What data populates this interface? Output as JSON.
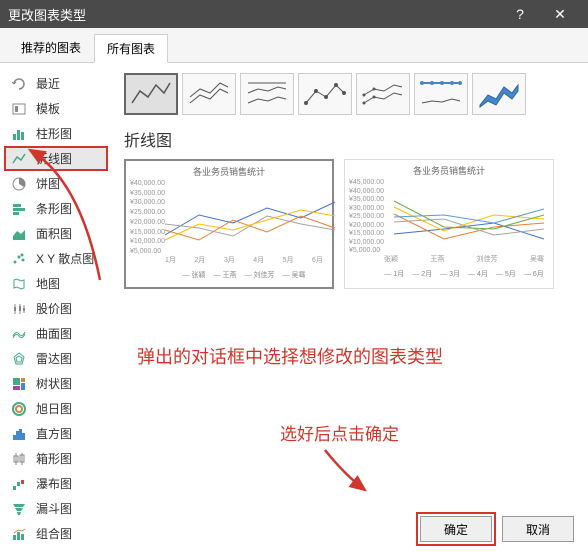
{
  "titlebar": {
    "title": "更改图表类型"
  },
  "tabs": {
    "recommended": "推荐的图表",
    "all": "所有图表"
  },
  "sidebar": {
    "items": [
      {
        "label": "最近"
      },
      {
        "label": "模板"
      },
      {
        "label": "柱形图"
      },
      {
        "label": "折线图"
      },
      {
        "label": "饼图"
      },
      {
        "label": "条形图"
      },
      {
        "label": "面积图"
      },
      {
        "label": "X Y 散点图"
      },
      {
        "label": "地图"
      },
      {
        "label": "股价图"
      },
      {
        "label": "曲面图"
      },
      {
        "label": "雷达图"
      },
      {
        "label": "树状图"
      },
      {
        "label": "旭日图"
      },
      {
        "label": "直方图"
      },
      {
        "label": "箱形图"
      },
      {
        "label": "瀑布图"
      },
      {
        "label": "漏斗图"
      },
      {
        "label": "组合图"
      }
    ]
  },
  "main": {
    "section_title": "折线图"
  },
  "chart_data": [
    {
      "type": "line",
      "title": "各业务员销售统计",
      "categories": [
        "1月",
        "2月",
        "3月",
        "4月",
        "5月",
        "6月"
      ],
      "ylim": [
        5000,
        40000
      ],
      "y_ticks": [
        "¥40,000.00",
        "¥35,000.00",
        "¥30,000.00",
        "¥25,000.00",
        "¥20,000.00",
        "¥15,000.00",
        "¥10,000.00",
        "¥5,000.00"
      ],
      "series": [
        {
          "name": "张颖",
          "values": [
            12000,
            22000,
            18000,
            25000,
            20000,
            28000
          ]
        },
        {
          "name": "王燕",
          "values": [
            15000,
            10000,
            20000,
            14000,
            22000,
            16000
          ]
        },
        {
          "name": "刘佳芳",
          "values": [
            18000,
            16000,
            12000,
            22000,
            18000,
            15000
          ]
        },
        {
          "name": "吴骞",
          "values": [
            10000,
            18000,
            15000,
            20000,
            25000,
            22000
          ]
        }
      ]
    },
    {
      "type": "line",
      "title": "各业务员销售统计",
      "categories": [
        "张颖",
        "王燕",
        "刘佳芳",
        "吴骞"
      ],
      "ylim": [
        5000,
        45000
      ],
      "y_ticks": [
        "¥45,000.00",
        "¥40,000.00",
        "¥35,000.00",
        "¥30,000.00",
        "¥25,000.00",
        "¥20,000.00",
        "¥15,000.00",
        "¥10,000.00",
        "¥5,000.00"
      ],
      "series": [
        {
          "name": "1月",
          "values": [
            12000,
            15000,
            18000,
            10000
          ]
        },
        {
          "name": "2月",
          "values": [
            22000,
            10000,
            16000,
            18000
          ]
        },
        {
          "name": "3月",
          "values": [
            18000,
            20000,
            12000,
            15000
          ]
        },
        {
          "name": "4月",
          "values": [
            25000,
            14000,
            22000,
            20000
          ]
        },
        {
          "name": "5月",
          "values": [
            20000,
            22000,
            18000,
            25000
          ]
        },
        {
          "name": "6月",
          "values": [
            28000,
            16000,
            15000,
            22000
          ]
        }
      ]
    }
  ],
  "annotations": {
    "instruction1": "弹出的对话框中选择想修改的图表类型",
    "instruction2": "选好后点击确定"
  },
  "footer": {
    "ok": "确定",
    "cancel": "取消"
  }
}
